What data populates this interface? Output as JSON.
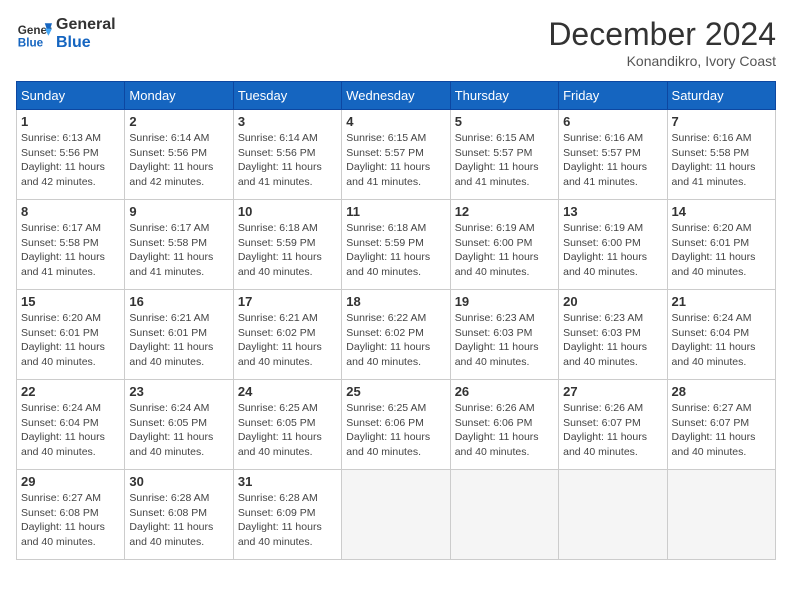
{
  "header": {
    "logo_line1": "General",
    "logo_line2": "Blue",
    "month": "December 2024",
    "location": "Konandikro, Ivory Coast"
  },
  "weekdays": [
    "Sunday",
    "Monday",
    "Tuesday",
    "Wednesday",
    "Thursday",
    "Friday",
    "Saturday"
  ],
  "weeks": [
    [
      {
        "day": "1",
        "sunrise": "6:13 AM",
        "sunset": "5:56 PM",
        "daylight": "11 hours and 42 minutes."
      },
      {
        "day": "2",
        "sunrise": "6:14 AM",
        "sunset": "5:56 PM",
        "daylight": "11 hours and 42 minutes."
      },
      {
        "day": "3",
        "sunrise": "6:14 AM",
        "sunset": "5:56 PM",
        "daylight": "11 hours and 41 minutes."
      },
      {
        "day": "4",
        "sunrise": "6:15 AM",
        "sunset": "5:57 PM",
        "daylight": "11 hours and 41 minutes."
      },
      {
        "day": "5",
        "sunrise": "6:15 AM",
        "sunset": "5:57 PM",
        "daylight": "11 hours and 41 minutes."
      },
      {
        "day": "6",
        "sunrise": "6:16 AM",
        "sunset": "5:57 PM",
        "daylight": "11 hours and 41 minutes."
      },
      {
        "day": "7",
        "sunrise": "6:16 AM",
        "sunset": "5:58 PM",
        "daylight": "11 hours and 41 minutes."
      }
    ],
    [
      {
        "day": "8",
        "sunrise": "6:17 AM",
        "sunset": "5:58 PM",
        "daylight": "11 hours and 41 minutes."
      },
      {
        "day": "9",
        "sunrise": "6:17 AM",
        "sunset": "5:58 PM",
        "daylight": "11 hours and 41 minutes."
      },
      {
        "day": "10",
        "sunrise": "6:18 AM",
        "sunset": "5:59 PM",
        "daylight": "11 hours and 40 minutes."
      },
      {
        "day": "11",
        "sunrise": "6:18 AM",
        "sunset": "5:59 PM",
        "daylight": "11 hours and 40 minutes."
      },
      {
        "day": "12",
        "sunrise": "6:19 AM",
        "sunset": "6:00 PM",
        "daylight": "11 hours and 40 minutes."
      },
      {
        "day": "13",
        "sunrise": "6:19 AM",
        "sunset": "6:00 PM",
        "daylight": "11 hours and 40 minutes."
      },
      {
        "day": "14",
        "sunrise": "6:20 AM",
        "sunset": "6:01 PM",
        "daylight": "11 hours and 40 minutes."
      }
    ],
    [
      {
        "day": "15",
        "sunrise": "6:20 AM",
        "sunset": "6:01 PM",
        "daylight": "11 hours and 40 minutes."
      },
      {
        "day": "16",
        "sunrise": "6:21 AM",
        "sunset": "6:01 PM",
        "daylight": "11 hours and 40 minutes."
      },
      {
        "day": "17",
        "sunrise": "6:21 AM",
        "sunset": "6:02 PM",
        "daylight": "11 hours and 40 minutes."
      },
      {
        "day": "18",
        "sunrise": "6:22 AM",
        "sunset": "6:02 PM",
        "daylight": "11 hours and 40 minutes."
      },
      {
        "day": "19",
        "sunrise": "6:23 AM",
        "sunset": "6:03 PM",
        "daylight": "11 hours and 40 minutes."
      },
      {
        "day": "20",
        "sunrise": "6:23 AM",
        "sunset": "6:03 PM",
        "daylight": "11 hours and 40 minutes."
      },
      {
        "day": "21",
        "sunrise": "6:24 AM",
        "sunset": "6:04 PM",
        "daylight": "11 hours and 40 minutes."
      }
    ],
    [
      {
        "day": "22",
        "sunrise": "6:24 AM",
        "sunset": "6:04 PM",
        "daylight": "11 hours and 40 minutes."
      },
      {
        "day": "23",
        "sunrise": "6:24 AM",
        "sunset": "6:05 PM",
        "daylight": "11 hours and 40 minutes."
      },
      {
        "day": "24",
        "sunrise": "6:25 AM",
        "sunset": "6:05 PM",
        "daylight": "11 hours and 40 minutes."
      },
      {
        "day": "25",
        "sunrise": "6:25 AM",
        "sunset": "6:06 PM",
        "daylight": "11 hours and 40 minutes."
      },
      {
        "day": "26",
        "sunrise": "6:26 AM",
        "sunset": "6:06 PM",
        "daylight": "11 hours and 40 minutes."
      },
      {
        "day": "27",
        "sunrise": "6:26 AM",
        "sunset": "6:07 PM",
        "daylight": "11 hours and 40 minutes."
      },
      {
        "day": "28",
        "sunrise": "6:27 AM",
        "sunset": "6:07 PM",
        "daylight": "11 hours and 40 minutes."
      }
    ],
    [
      {
        "day": "29",
        "sunrise": "6:27 AM",
        "sunset": "6:08 PM",
        "daylight": "11 hours and 40 minutes."
      },
      {
        "day": "30",
        "sunrise": "6:28 AM",
        "sunset": "6:08 PM",
        "daylight": "11 hours and 40 minutes."
      },
      {
        "day": "31",
        "sunrise": "6:28 AM",
        "sunset": "6:09 PM",
        "daylight": "11 hours and 40 minutes."
      },
      null,
      null,
      null,
      null
    ]
  ]
}
